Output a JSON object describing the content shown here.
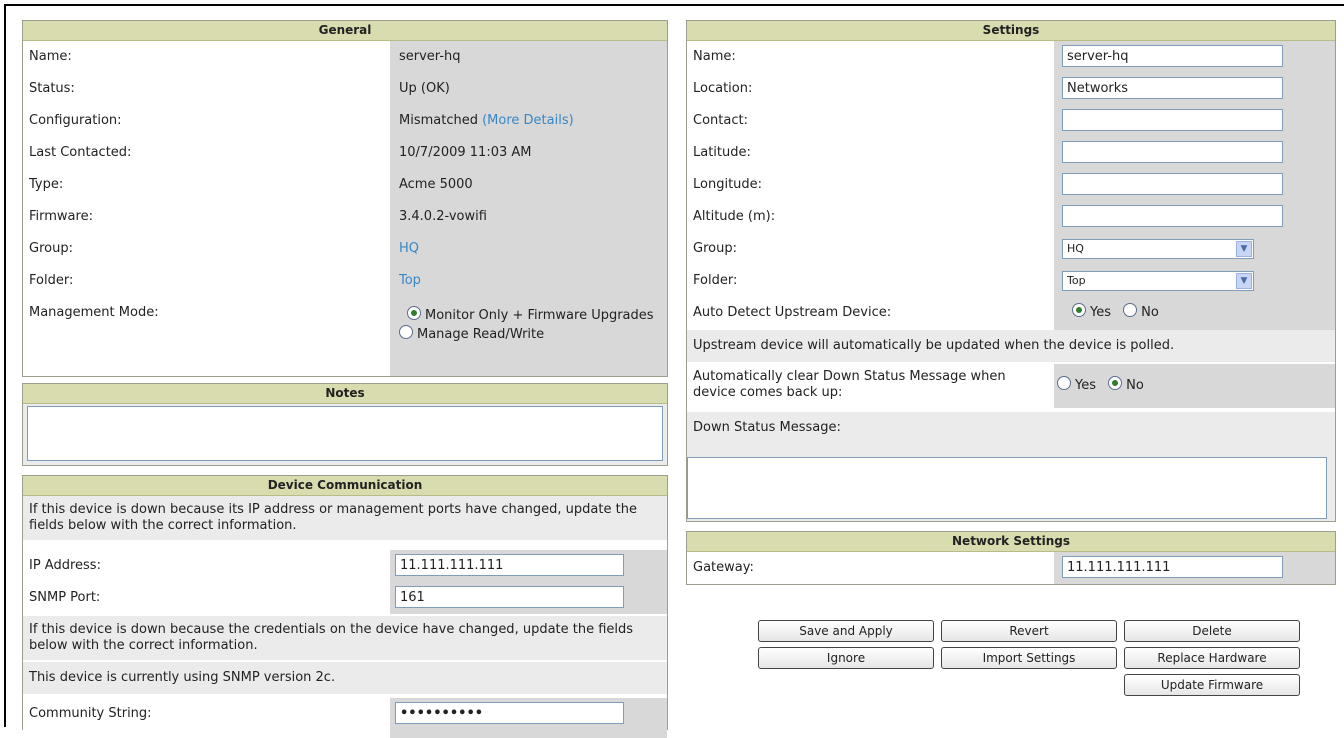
{
  "general": {
    "title": "General",
    "rows": [
      {
        "label": "Name:",
        "value": "server-hq"
      },
      {
        "label": "Status:",
        "value": "Up (OK)"
      },
      {
        "label": "Configuration:",
        "value": "Mismatched",
        "link": "(More Details)"
      },
      {
        "label": "Last Contacted:",
        "value": "10/7/2009 11:03 AM"
      },
      {
        "label": "Type:",
        "value": "Acme 5000"
      },
      {
        "label": "Firmware:",
        "value": "3.4.0.2-vowifi"
      },
      {
        "label": "Group:",
        "value": "HQ"
      },
      {
        "label": "Folder:",
        "value": "Top"
      }
    ],
    "mode_label": "Management Mode:",
    "mode_option1": "Monitor Only + Firmware Upgrades",
    "mode_option2": "Manage Read/Write"
  },
  "notes": {
    "title": "Notes"
  },
  "device_comm": {
    "title": "Device Communication",
    "intro": "If this device is down because its IP address or management ports have changed, update the fields below with the correct information.",
    "ip_label": "IP Address:",
    "ip_value": "11.111.111.111",
    "snmp_label": "SNMP Port:",
    "snmp_value": "161",
    "cred_note": "If this device is down because the credentials on the device have changed, update the fields below with the correct information.",
    "snmp_version_note": "This device is currently using SNMP version 2c.",
    "community_label": "Community String:",
    "community_value": "••••••••••"
  },
  "settings": {
    "title": "Settings",
    "name_label": "Name:",
    "name_value": "server-hq",
    "location_label": "Location:",
    "location_value": "Networks",
    "contact_label": "Contact:",
    "contact_value": "",
    "latitude_label": "Latitude:",
    "latitude_value": "",
    "longitude_label": "Longitude:",
    "longitude_value": "",
    "altitude_label": "Altitude (m):",
    "altitude_value": "",
    "group_label": "Group:",
    "group_value": "HQ",
    "folder_label": "Folder:",
    "folder_value": "Top",
    "auto_detect_label": "Auto Detect Upstream Device:",
    "yes": "Yes",
    "no": "No",
    "upstream_note": "Upstream device will automatically be updated when the device is polled.",
    "auto_clear_label": "Automatically clear Down Status Message when device comes back up:",
    "down_msg_label": "Down Status Message:"
  },
  "network": {
    "title": "Network Settings",
    "gateway_label": "Gateway:",
    "gateway_value": "11.111.111.111"
  },
  "buttons": {
    "save_apply": "Save and Apply",
    "revert": "Revert",
    "delete": "Delete",
    "ignore": "Ignore",
    "import_settings": "Import Settings",
    "replace_hardware": "Replace Hardware",
    "update_firmware": "Update Firmware"
  }
}
